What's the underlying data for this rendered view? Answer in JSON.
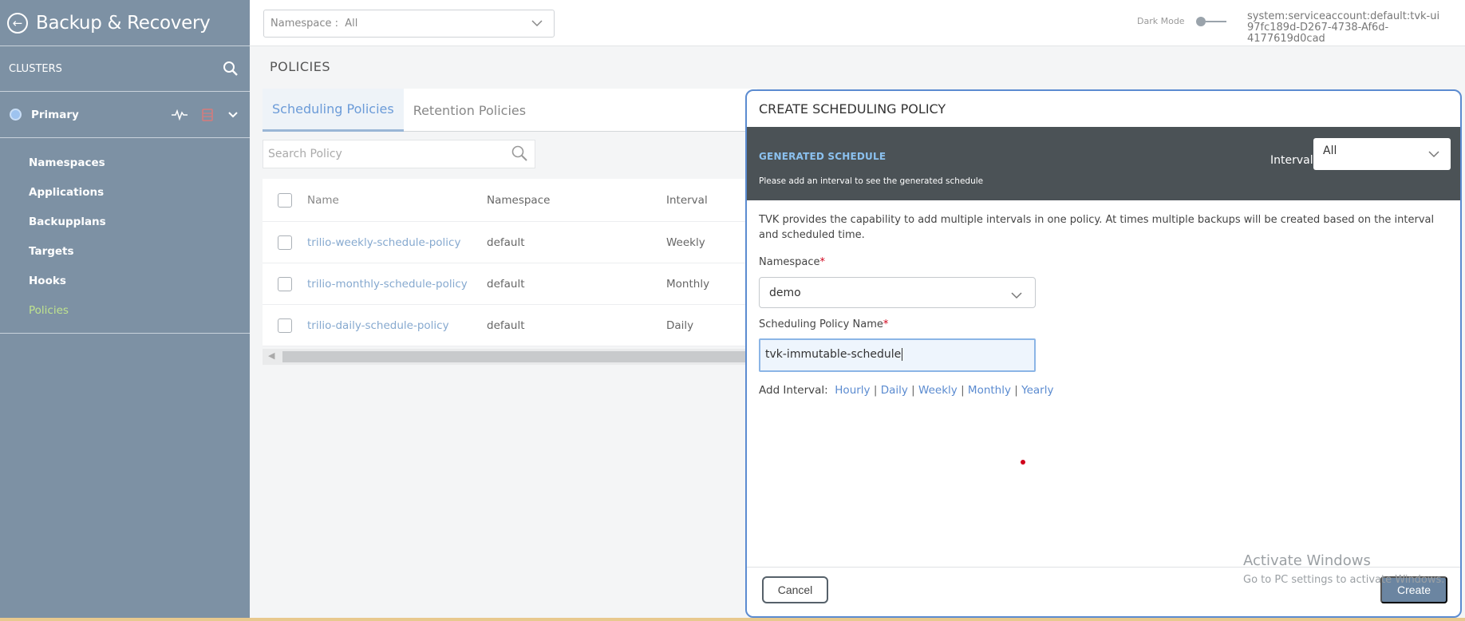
{
  "app": {
    "title": "Backup & Recovery"
  },
  "sidebar": {
    "clusters_label": "CLUSTERS",
    "cluster_name": "Primary",
    "items": [
      {
        "label": "Namespaces"
      },
      {
        "label": "Applications"
      },
      {
        "label": "Backupplans"
      },
      {
        "label": "Targets"
      },
      {
        "label": "Hooks"
      },
      {
        "label": "Policies",
        "active": true
      }
    ]
  },
  "topbar": {
    "namespace_label": "Namespace :",
    "namespace_value": "All",
    "dark_mode_label": "Dark Mode",
    "account_line1": "system:serviceaccount:default:tvk-ui",
    "account_line2": "97fc189d-D267-4738-Af6d-4177619d0cad"
  },
  "page": {
    "title": "POLICIES",
    "tabs": [
      {
        "label": "Scheduling Policies",
        "active": true
      },
      {
        "label": "Retention Policies",
        "active": false
      }
    ],
    "search_placeholder": "Search Policy",
    "table": {
      "headers": {
        "name": "Name",
        "namespace": "Namespace",
        "interval": "Interval"
      },
      "rows": [
        {
          "name": "trilio-weekly-schedule-policy",
          "namespace": "default",
          "interval": "Weekly"
        },
        {
          "name": "trilio-monthly-schedule-policy",
          "namespace": "default",
          "interval": "Monthly"
        },
        {
          "name": "trilio-daily-schedule-policy",
          "namespace": "default",
          "interval": "Daily"
        }
      ]
    }
  },
  "modal": {
    "title": "CREATE SCHEDULING POLICY",
    "generated_title": "GENERATED SCHEDULE",
    "generated_subtitle": "Please add an interval to see the generated schedule",
    "interval_label": "Interval:",
    "interval_value": "All",
    "description": "TVK provides the capability to add multiple intervals in one policy. At times multiple backups will be created based on the interval and scheduled time.",
    "namespace_label": "Namespace",
    "namespace_value": "demo",
    "policy_name_label": "Scheduling Policy Name",
    "policy_name_value": "tvk-immutable-schedule",
    "required_mark": "*",
    "add_interval_label": "Add Interval:",
    "interval_links": [
      "Hourly",
      "Daily",
      "Weekly",
      "Monthly",
      "Yearly"
    ],
    "cancel_label": "Cancel",
    "create_label": "Create"
  },
  "watermark": {
    "line1": "Activate Windows",
    "line2": "Go to PC settings to activate Windows."
  },
  "colors": {
    "sidebar_bg": "#7d91a4",
    "active_nav": "#bfe38e",
    "link": "#5b8bd0",
    "modal_border": "#5b8bd0",
    "create_button": "#6b85a1",
    "required": "#d0021b"
  },
  "icons": [
    "back-arrow-icon",
    "search-icon",
    "pulse-icon",
    "database-icon",
    "chevron-down-icon"
  ]
}
